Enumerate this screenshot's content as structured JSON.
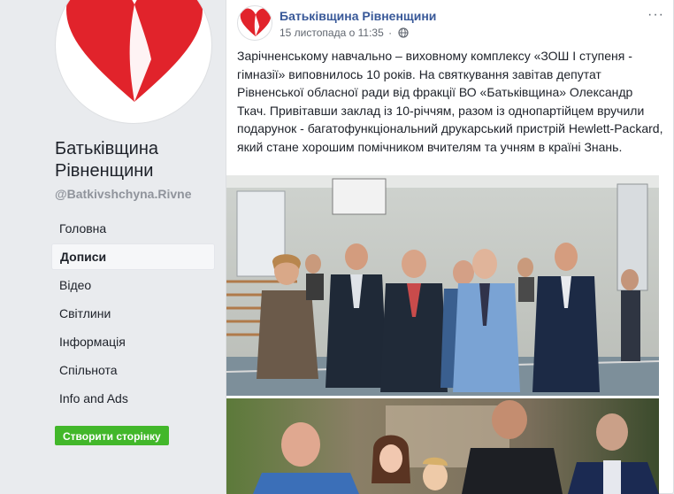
{
  "page": {
    "name": "Батьківщина Рівненщини",
    "handle": "@Batkivshchyna.Rivne"
  },
  "nav": {
    "items": [
      {
        "label": "Головна",
        "active": false
      },
      {
        "label": "Дописи",
        "active": true
      },
      {
        "label": "Відео",
        "active": false
      },
      {
        "label": "Світлини",
        "active": false
      },
      {
        "label": "Інформація",
        "active": false
      },
      {
        "label": "Спільнота",
        "active": false
      },
      {
        "label": "Info and Ads",
        "active": false
      }
    ],
    "create_page_label": "Створити сторінку"
  },
  "post": {
    "author": "Батьківщина Рівненщини",
    "timestamp": "15 листопада о 11:35",
    "separator": "·",
    "privacy_icon": "globe-icon",
    "more_label": "···",
    "text": "Зарічненському навчально – виховному комплексу «ЗОШ І ступеня - гімназії» виповнилось 10 років. На святкування завітав депутат Рівненської обласної ради від фракції ВО «Батьківщина» Олександр Ткач. Привітавши заклад із 10-річчям, разом із однопартійцем вручили подарунок - багатофункціональний друкарський пристрій Hewlett-Packard, який стане хорошим помічником вчителям та учням в країні Знань."
  },
  "colors": {
    "brand_red": "#e1232b",
    "link_blue": "#385898",
    "create_green": "#42b72a",
    "background": "#e9ebee"
  }
}
